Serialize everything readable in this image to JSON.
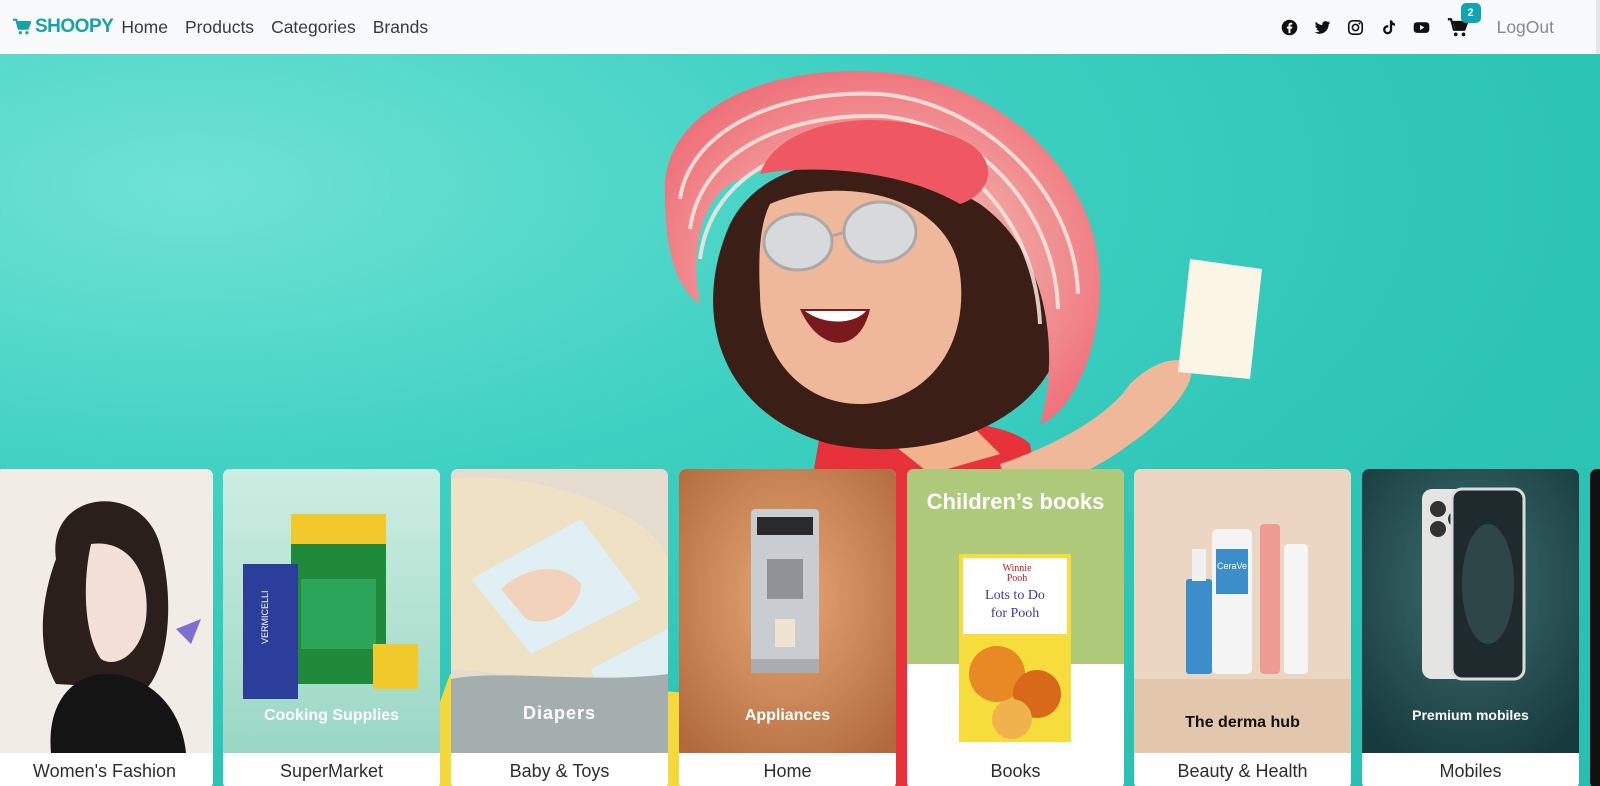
{
  "nav": {
    "brand": "SHOOPY",
    "links": [
      "Home",
      "Products",
      "Categories",
      "Brands"
    ],
    "social_icons": [
      "facebook-icon",
      "twitter-icon",
      "instagram-icon",
      "tiktok-icon",
      "youtube-icon"
    ],
    "cart_count": "2",
    "logout_label": "LogOut"
  },
  "colors": {
    "brand": "#1aa0a8",
    "hero_bg": "#3fd1c2",
    "badge": "#0fa4b1"
  },
  "categories": [
    {
      "label": "Women's Fashion",
      "promo": ""
    },
    {
      "label": "SuperMarket",
      "promo": "Cooking Supplies"
    },
    {
      "label": "Baby & Toys",
      "promo": "Diapers"
    },
    {
      "label": "Home",
      "promo": "Appliances"
    },
    {
      "label": "Books",
      "promo": "Children’s books"
    },
    {
      "label": "Beauty & Health",
      "promo": "The derma hub"
    },
    {
      "label": "Mobiles",
      "promo": "Premium mobiles"
    }
  ],
  "book": {
    "title_line1": "Winnie",
    "title_line2": "Pooh",
    "cover_line1": "Lots to Do",
    "cover_line2": "for Pooh"
  },
  "products": {
    "derma_brand": "CeraVe",
    "vermicelli": "VERMICELLI"
  }
}
